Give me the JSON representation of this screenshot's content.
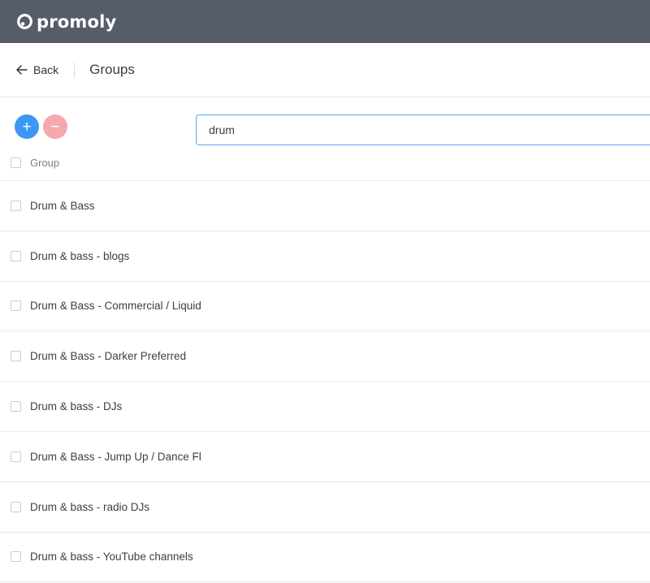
{
  "brand": {
    "name": "promoly"
  },
  "nav": {
    "back_label": "Back",
    "title": "Groups"
  },
  "actions": {
    "add_symbol": "+",
    "remove_symbol": "−"
  },
  "search": {
    "value": "drum"
  },
  "table": {
    "header": "Group",
    "rows": [
      "Drum & Bass",
      "Drum & bass - blogs",
      "Drum & Bass - Commercial / Liquid",
      "Drum & Bass - Darker Preferred",
      "Drum & bass - DJs",
      "Drum & Bass - Jump Up / Dance Fl",
      "Drum & bass - radio DJs",
      "Drum & bass - YouTube channels"
    ]
  },
  "colors": {
    "topbar": "#565d68",
    "add_button": "#3d97f5",
    "remove_button": "#f5a9ad",
    "search_border": "#5aa6ee"
  },
  "icons": {
    "logo": "promoly-logo-icon",
    "back": "arrow-left-icon",
    "add": "plus-icon",
    "remove": "minus-icon"
  }
}
